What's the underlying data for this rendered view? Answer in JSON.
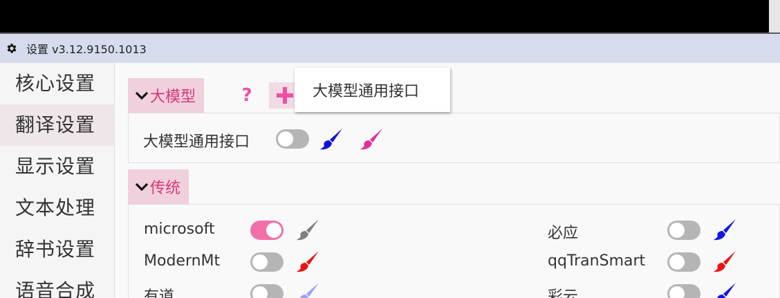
{
  "window": {
    "title": "设置 v3.12.9150.1013"
  },
  "sidebar": {
    "items": [
      {
        "label": "核心设置",
        "active": false
      },
      {
        "label": "翻译设置",
        "active": true
      },
      {
        "label": "显示设置",
        "active": false
      },
      {
        "label": "文本处理",
        "active": false
      },
      {
        "label": "辞书设置",
        "active": false
      },
      {
        "label": "语音合成",
        "active": false
      }
    ]
  },
  "sections": {
    "llm": {
      "title": "大模型",
      "toolbar": {
        "help": "?",
        "add": "+",
        "remove": "−"
      },
      "rows": [
        {
          "label": "大模型通用接口",
          "enabled": false,
          "color": "#1010e0"
        }
      ]
    },
    "traditional": {
      "title": "传统",
      "left": [
        {
          "label": "microsoft",
          "enabled": true,
          "color": "#808080"
        },
        {
          "label": "ModernMt",
          "enabled": false,
          "color": "#ee1111"
        },
        {
          "label": "有道",
          "enabled": false,
          "color": "#9aa2f5"
        }
      ],
      "right": [
        {
          "label": "必应",
          "enabled": false,
          "color": "#1414e6"
        },
        {
          "label": "qqTranSmart",
          "enabled": false,
          "color": "#ee1111"
        },
        {
          "label": "彩云",
          "enabled": false,
          "color": "#1414e6"
        }
      ]
    }
  },
  "tooltip": {
    "text": "大模型通用接口"
  },
  "colors": {
    "accent": "#f36fa7",
    "header_bg": "#efd0dc",
    "header_text": "#d6387a",
    "titlebar_bg": "#d6dcee"
  },
  "icons": {
    "window": "gear-icon",
    "section": "chevron-down-icon",
    "color_picker": "paint-brush-icon"
  }
}
